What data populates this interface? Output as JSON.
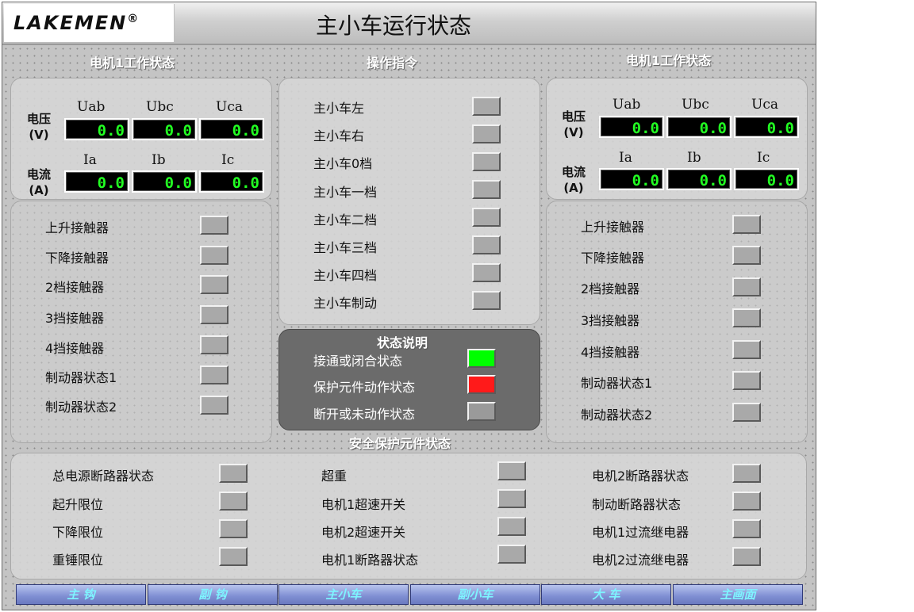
{
  "header": {
    "logo_text": "LAKEMEN",
    "logo_mark": "®",
    "title": "主小车运行状态"
  },
  "motor1": {
    "title": "电机1工作状态",
    "voltage_label": "电压",
    "voltage_unit": "(V)",
    "current_label": "电流",
    "current_unit": "(A)",
    "voltage_cols": [
      "Uab",
      "Ubc",
      "Uca"
    ],
    "current_cols": [
      "Ia",
      "Ib",
      "Ic"
    ],
    "voltage_values": [
      "0.0",
      "0.0",
      "0.0"
    ],
    "current_values": [
      "0.0",
      "0.0",
      "0.0"
    ],
    "rows": [
      "上升接触器",
      "下降接触器",
      "2档接触器",
      "3挡接触器",
      "4挡接触器",
      "制动器状态1",
      "制动器状态2"
    ]
  },
  "motor2": {
    "title": "电机1工作状态",
    "voltage_label": "电压",
    "voltage_unit": "(V)",
    "current_label": "电流",
    "current_unit": "(A)",
    "voltage_cols": [
      "Uab",
      "Ubc",
      "Uca"
    ],
    "current_cols": [
      "Ia",
      "Ib",
      "Ic"
    ],
    "voltage_values": [
      "0.0",
      "0.0",
      "0.0"
    ],
    "current_values": [
      "0.0",
      "0.0",
      "0.0"
    ],
    "rows": [
      "上升接触器",
      "下降接触器",
      "2档接触器",
      "3挡接触器",
      "4挡接触器",
      "制动器状态1",
      "制动器状态2"
    ]
  },
  "commands": {
    "title": "操作指令",
    "rows": [
      "主小车左",
      "主小车右",
      "主小车0档",
      "主小车一档",
      "主小车二档",
      "主小车三档",
      "主小车四档",
      "主小车制动"
    ]
  },
  "legend": {
    "title": "状态说明",
    "items": [
      {
        "label": "接通或闭合状态",
        "color": "#00ff00"
      },
      {
        "label": "保护元件动作状态",
        "color": "#ff1a1a"
      },
      {
        "label": "断开或未动作状态",
        "color": "#9a9a9a"
      }
    ]
  },
  "safety": {
    "title": "安全保护元件状态",
    "col1": [
      "总电源断路器状态",
      "起升限位",
      "下降限位",
      "重锤限位"
    ],
    "col2": [
      "超重",
      "电机1超速开关",
      "电机2超速开关",
      "电机1断路器状态"
    ],
    "col3": [
      "电机2断路器状态",
      "制动断路器状态",
      "电机1过流继电器",
      "电机2过流继电器"
    ]
  },
  "colors": {
    "indicator_off": "#a9a9a9",
    "readout_text": "#22ff22",
    "nav_text": "#7ef4ff"
  },
  "nav": [
    "主 钩",
    "副 钩",
    "主小车",
    "副小车",
    "大 车",
    "主画面"
  ]
}
